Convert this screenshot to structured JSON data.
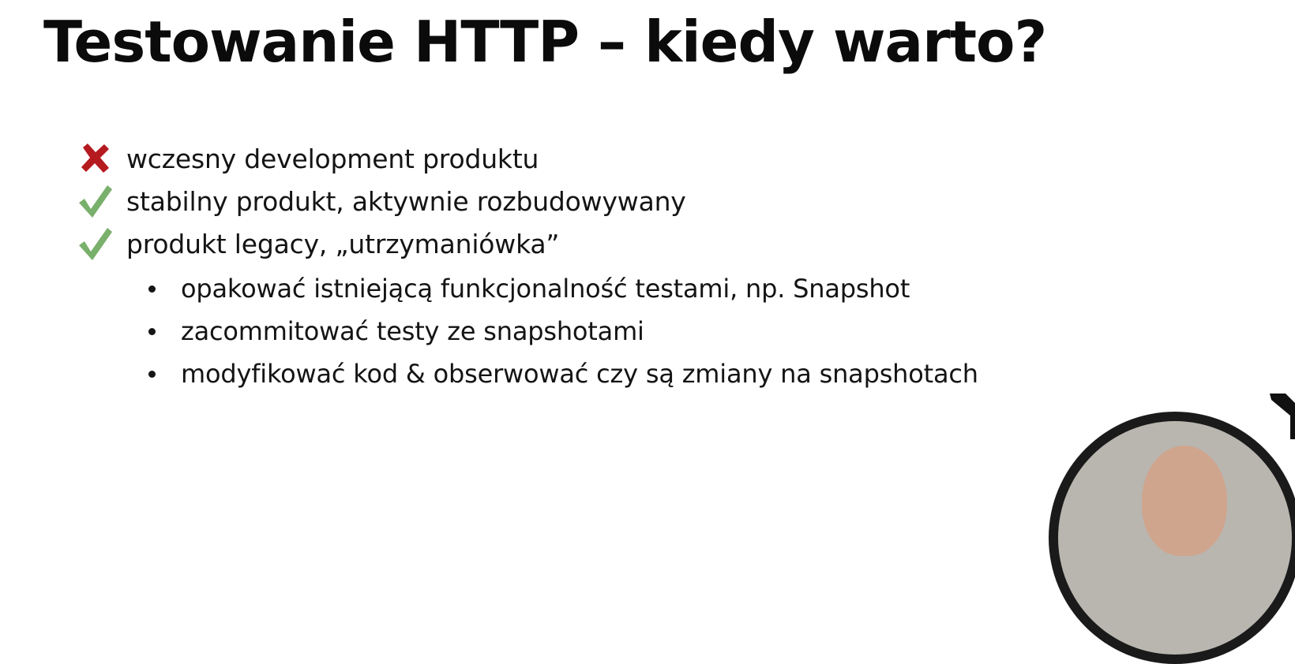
{
  "slide": {
    "title": "Testowanie HTTP – kiedy warto?",
    "items": [
      {
        "icon": "cross-icon",
        "text": "wczesny development produktu"
      },
      {
        "icon": "checkmark-icon",
        "text": "stabilny produkt, aktywnie rozbudowywany"
      },
      {
        "icon": "checkmark-icon",
        "text": "produkt legacy, „utrzymaniówka”"
      }
    ],
    "subitems": [
      "opakować istniejącą funkcjonalność testami, np. Snapshot",
      "zacommitować testy ze snapshotami",
      "modyfikować kod & obserwować czy są zmiany na snapshotach"
    ]
  },
  "colors": {
    "cross": "#b51a1f",
    "check": "#79b06b",
    "text": "#141414",
    "webcam_ring": "#1a1a1a"
  }
}
